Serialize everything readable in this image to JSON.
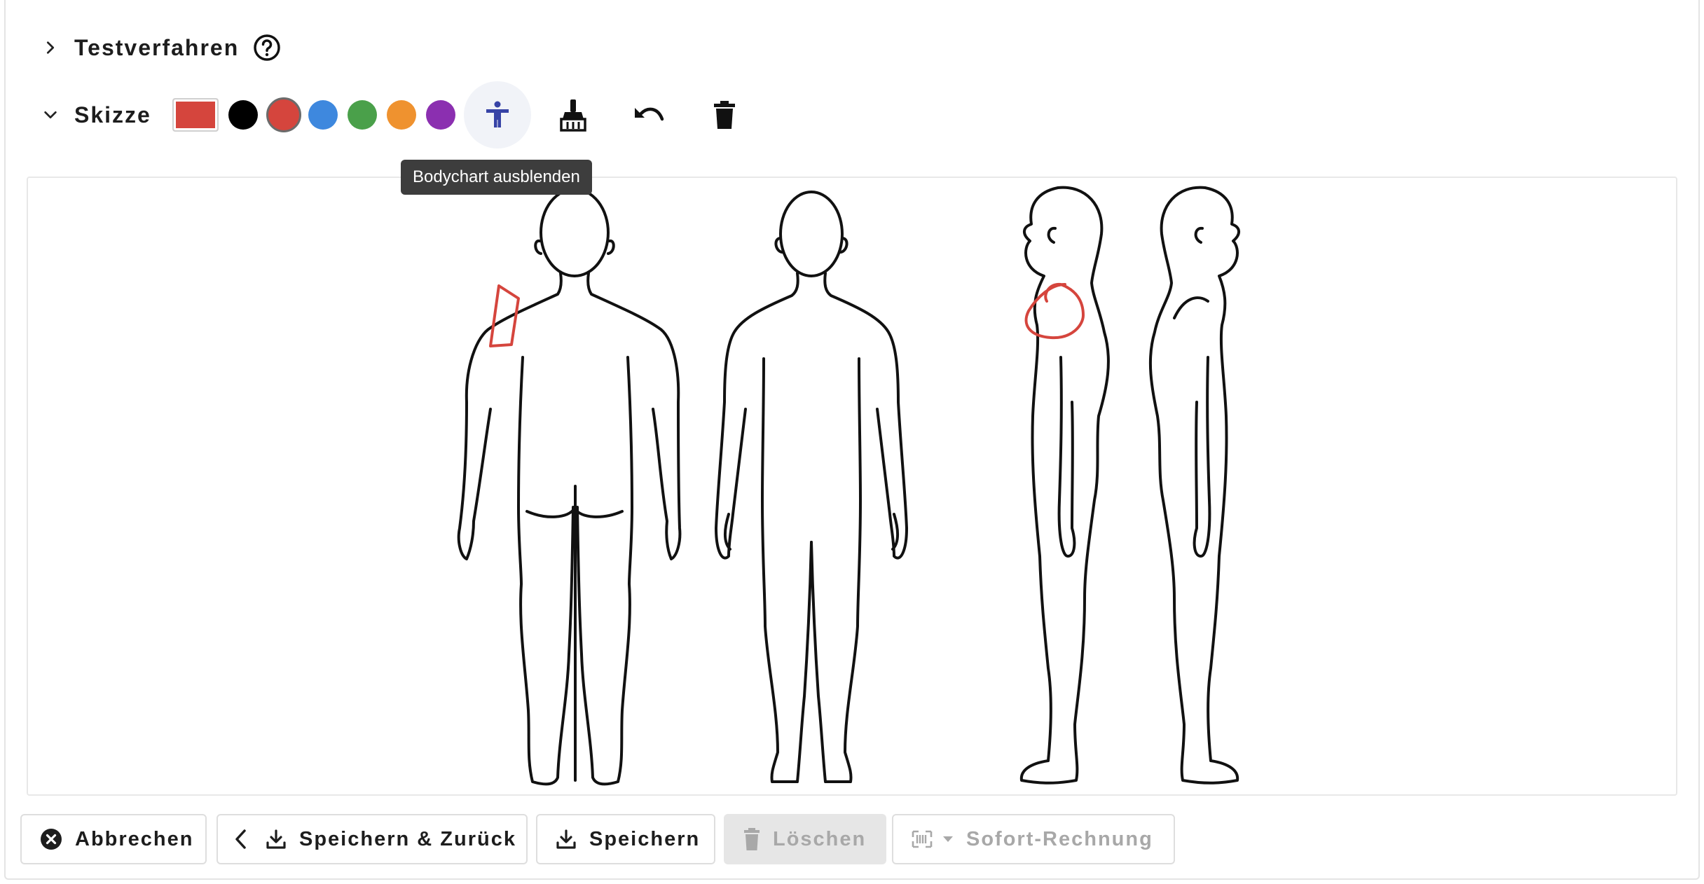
{
  "sections": {
    "testverfahren": {
      "title": "Testverfahren",
      "icon": "help-circle-icon"
    },
    "skizze": {
      "title": "Skizze"
    }
  },
  "toolbar": {
    "selected_color": "#d5453d",
    "colors": [
      "#000000",
      "#d5453d",
      "#3e88de",
      "#4aa04a",
      "#ef922f",
      "#8b2fb0"
    ],
    "tools": [
      "accessibility-icon",
      "brush-icon",
      "undo-icon",
      "trash-icon"
    ],
    "tooltip": "Bodychart ausblenden"
  },
  "actions": {
    "cancel": "Abbrechen",
    "save_back": "Speichern & Zurück",
    "save": "Speichern",
    "delete": "Löschen",
    "invoice": "Sofort-Rechnung"
  }
}
